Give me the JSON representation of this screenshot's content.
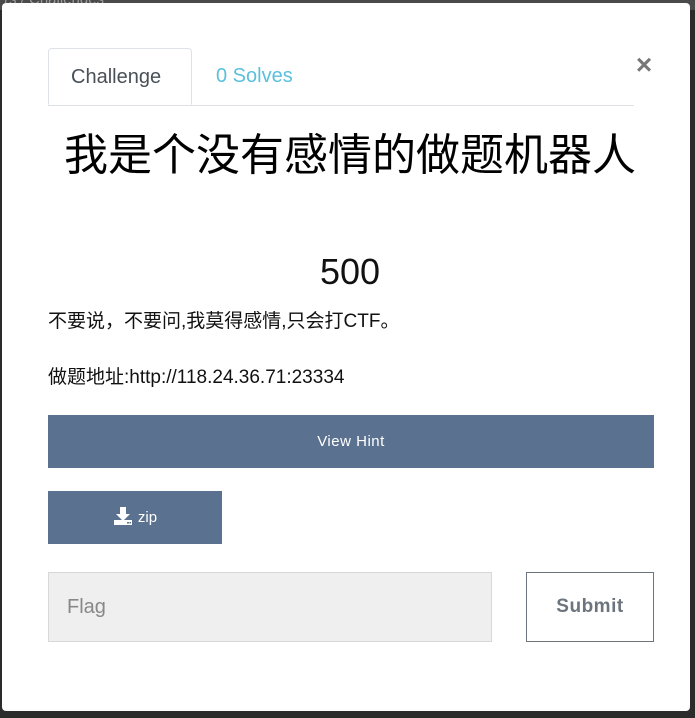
{
  "background": {
    "breadcrumb": "rs  /  Challenges"
  },
  "modal": {
    "tabs": [
      {
        "label": "Challenge",
        "active": true
      },
      {
        "label": "0 Solves",
        "active": false
      }
    ],
    "close_label": "×",
    "title": "我是个没有感情的做题机器人",
    "points": "500",
    "description_lines": [
      "不要说，不要问,我莫得感情,只会打CTF。",
      "做题地址:http://118.24.36.71:23334"
    ],
    "hint_button_label": "View Hint",
    "file_button": {
      "label": "zip",
      "icon": "download-icon"
    },
    "flag_input": {
      "placeholder": "Flag",
      "value": ""
    },
    "submit_label": "Submit"
  },
  "colors": {
    "button_bg": "#5b7190",
    "tab_link": "#5bc0de",
    "input_bg": "#efefef"
  }
}
